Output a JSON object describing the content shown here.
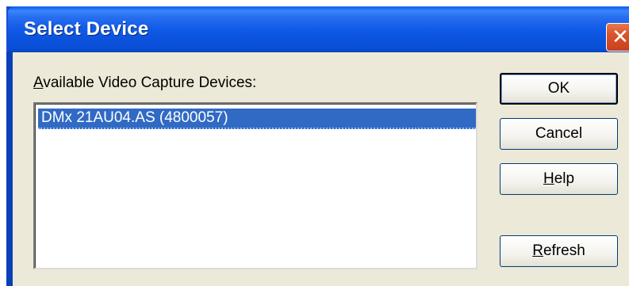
{
  "window": {
    "title": "Select Device",
    "close_glyph": "✕"
  },
  "list": {
    "label_first_char": "A",
    "label_rest": "vailable Video Capture Devices:",
    "items": [
      "DMx 21AU04.AS (4800057)"
    ],
    "selected_index": 0
  },
  "buttons": {
    "ok_label": "OK",
    "cancel_label": "Cancel",
    "help_prefix": "",
    "help_mnemonic": "H",
    "help_rest": "elp",
    "refresh_mnemonic": "R",
    "refresh_rest": "efresh"
  },
  "colors": {
    "titlebar": "#0a5ce8",
    "selection": "#316ac5",
    "dialog_bg": "#ece9d8",
    "close_button": "#d9532c"
  }
}
